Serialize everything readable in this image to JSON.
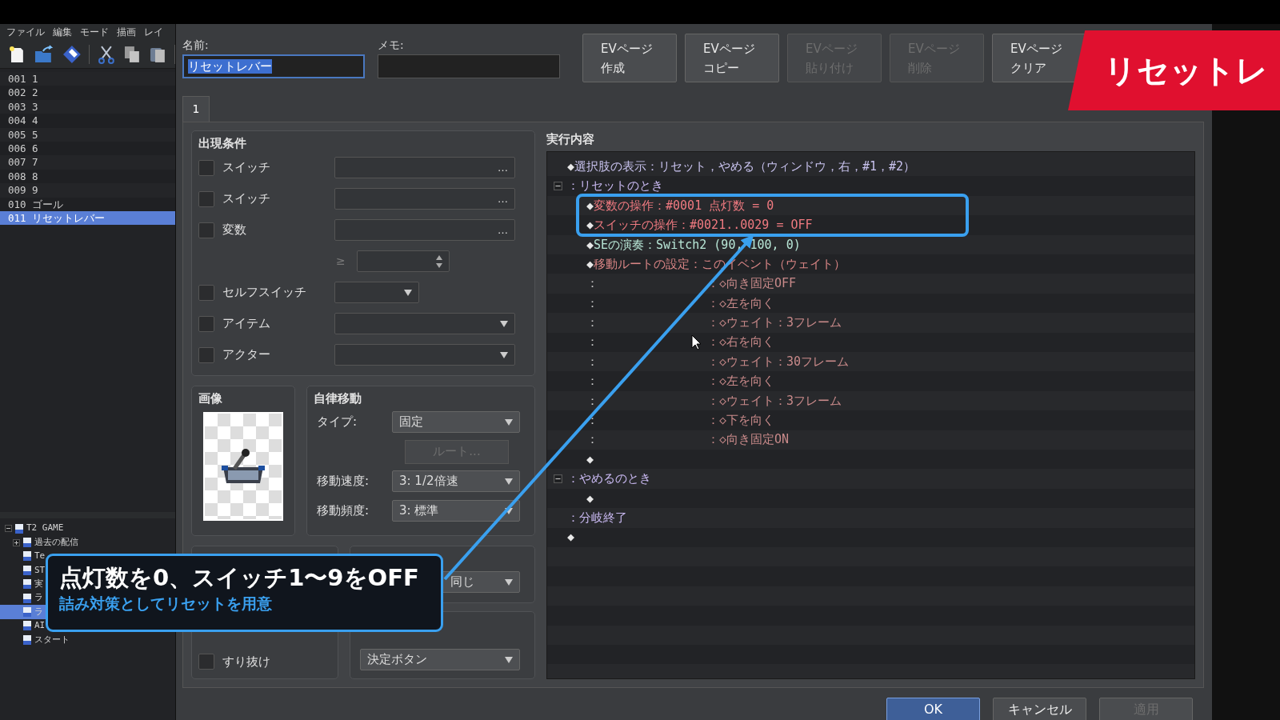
{
  "menu": [
    "ファイル",
    "編集",
    "モード",
    "描画",
    "レイ"
  ],
  "events": [
    {
      "number": "001",
      "name": "1",
      "selected": false
    },
    {
      "number": "002",
      "name": "2",
      "selected": false
    },
    {
      "number": "003",
      "name": "3",
      "selected": false
    },
    {
      "number": "004",
      "name": "4",
      "selected": false
    },
    {
      "number": "005",
      "name": "5",
      "selected": false
    },
    {
      "number": "006",
      "name": "6",
      "selected": false
    },
    {
      "number": "007",
      "name": "7",
      "selected": false
    },
    {
      "number": "008",
      "name": "8",
      "selected": false
    },
    {
      "number": "009",
      "name": "9",
      "selected": false
    },
    {
      "number": "010",
      "name": "ゴール",
      "selected": false
    },
    {
      "number": "011",
      "name": "リセットレバー",
      "selected": true
    }
  ],
  "project_tree": [
    {
      "label": "T2 GAME",
      "expanded": true,
      "selected": false,
      "children": [
        {
          "label": "過去の配信",
          "expanded": false,
          "selected": false
        },
        {
          "label": "Te",
          "selected": false
        },
        {
          "label": "ST",
          "selected": false
        },
        {
          "label": "実",
          "selected": false
        },
        {
          "label": "ラ",
          "selected": false
        },
        {
          "label": "ラ",
          "selected": true
        },
        {
          "label": "AI",
          "selected": false
        },
        {
          "label": "スタート",
          "selected": false
        }
      ]
    }
  ],
  "name_field": {
    "label": "名前:",
    "value": "リセットレバー"
  },
  "memo_field": {
    "label": "メモ:"
  },
  "ev_buttons": [
    {
      "lines": [
        "EVページ",
        "作成"
      ],
      "disabled": false
    },
    {
      "lines": [
        "EVページ",
        "コピー"
      ],
      "disabled": false
    },
    {
      "lines": [
        "EVページ",
        "貼り付け"
      ],
      "disabled": true
    },
    {
      "lines": [
        "EVページ",
        "削除"
      ],
      "disabled": true
    },
    {
      "lines": [
        "EVページ",
        "クリア"
      ],
      "disabled": false
    }
  ],
  "title_banner": "リセットレ",
  "page_tabs": [
    {
      "label": "1",
      "selected": true
    }
  ],
  "conditions": {
    "title": "出現条件",
    "rows": [
      {
        "kind": "picker",
        "label": "スイッチ",
        "checked": false,
        "button": "…"
      },
      {
        "kind": "picker",
        "label": "スイッチ",
        "checked": false,
        "button": "…"
      },
      {
        "kind": "picker",
        "label": "変数",
        "checked": false,
        "button": "…"
      },
      {
        "kind": "number",
        "sign": "≥"
      },
      {
        "kind": "short_select",
        "label": "セルフスイッチ",
        "checked": false
      },
      {
        "kind": "select",
        "label": "アイテム",
        "checked": false
      },
      {
        "kind": "select",
        "label": "アクター",
        "checked": false
      }
    ]
  },
  "image_panel": {
    "title": "画像"
  },
  "autonomous_movement": {
    "title": "自律移動",
    "rows": [
      {
        "kind": "select",
        "label": "タイプ:",
        "value": "固定"
      },
      {
        "kind": "button",
        "label": "ルート...",
        "disabled": true
      },
      {
        "kind": "select",
        "label": "移動速度:",
        "value": "3: 1/2倍速"
      },
      {
        "kind": "select",
        "label": "移動頻度:",
        "value": "3: 標準"
      }
    ]
  },
  "options": [
    {
      "label": "すり抜け",
      "checked": false
    }
  ],
  "priority": {
    "value": "同じ"
  },
  "trigger": {
    "value": "決定ボタン"
  },
  "contents": {
    "title": "実行内容",
    "commands": [
      {
        "kind": "command",
        "bullet": "◆",
        "text": "選択肢の表示：リセット，やめる（ウィンドウ，右，#1，#2）",
        "color": "#c8c2ee"
      },
      {
        "kind": "branch",
        "text": "：リセットのとき",
        "expanded": true,
        "color": "#c8b8f0",
        "children": [
          {
            "kind": "command",
            "bullet": "◆",
            "text": "変数の操作：#0001 点灯数 = 0",
            "color": "#f07a80"
          },
          {
            "kind": "command",
            "bullet": "◆",
            "text": "スイッチの操作：#0021..0029 = OFF",
            "color": "#f07a80"
          },
          {
            "kind": "command",
            "bullet": "◆",
            "text": "SEの演奏：Switch2 (90, 100, 0)",
            "color": "#b8e6d6"
          },
          {
            "kind": "command",
            "bullet": "◆",
            "text": "移動ルートの設定：このイベント（ウェイト）",
            "color": "#d98585"
          },
          {
            "kind": "route",
            "lead": "：",
            "text": "：◇向き固定OFF",
            "color": "#c98a8a"
          },
          {
            "kind": "route",
            "lead": "：",
            "text": "：◇左を向く",
            "color": "#c98a8a"
          },
          {
            "kind": "route",
            "lead": "：",
            "text": "：◇ウェイト：3フレーム",
            "color": "#c98a8a"
          },
          {
            "kind": "route",
            "lead": "：",
            "text": "：◇右を向く",
            "color": "#c98a8a"
          },
          {
            "kind": "route",
            "lead": "：",
            "text": "：◇ウェイト：30フレーム",
            "color": "#c98a8a"
          },
          {
            "kind": "route",
            "lead": "：",
            "text": "：◇左を向く",
            "color": "#c98a8a"
          },
          {
            "kind": "route",
            "lead": "：",
            "text": "：◇ウェイト：3フレーム",
            "color": "#c98a8a"
          },
          {
            "kind": "route",
            "lead": "：",
            "text": "：◇下を向く",
            "color": "#c98a8a"
          },
          {
            "kind": "route",
            "lead": "：",
            "text": "：◇向き固定ON",
            "color": "#c98a8a"
          },
          {
            "kind": "command",
            "bullet": "◆"
          }
        ]
      },
      {
        "kind": "branch",
        "text": "：やめるのとき",
        "expanded": true,
        "color": "#c8b8f0",
        "children": [
          {
            "kind": "command",
            "bullet": "◆"
          }
        ]
      },
      {
        "kind": "end",
        "text": "：分岐終了",
        "color": "#c8b8f0"
      },
      {
        "kind": "command",
        "bullet": "◆"
      }
    ]
  },
  "dialog_buttons": [
    {
      "label": "OK",
      "kind": "default"
    },
    {
      "label": "キャンセル",
      "kind": "normal"
    },
    {
      "label": "適用",
      "kind": "disabled"
    }
  ],
  "callout": {
    "title": "点灯数を0、スイッチ1〜9をOFF",
    "subtitle": "詰み対策としてリセットを用意"
  }
}
